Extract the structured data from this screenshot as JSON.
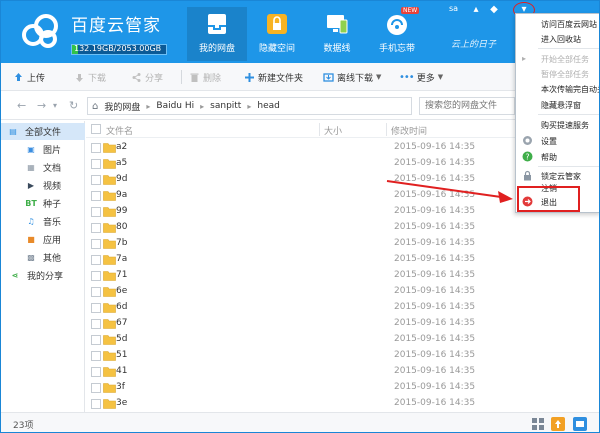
{
  "app": {
    "name": "百度云管家",
    "storage_text": "132.19GB/2053.00GB",
    "storage_used_fraction": 0.064,
    "slogan": "云上的日子",
    "username": "sa"
  },
  "nav": [
    {
      "label": "我的网盘",
      "icon": "cloud-drive-icon",
      "active": true
    },
    {
      "label": "隐藏空间",
      "icon": "lock-icon",
      "active": false
    },
    {
      "label": "数据线",
      "icon": "devices-icon",
      "active": false
    },
    {
      "label": "手机忘带",
      "icon": "phone-remote-icon",
      "active": false,
      "badge": "NEW"
    }
  ],
  "window_controls": {
    "menu": "▾",
    "minimize": "—",
    "maximize": "□",
    "close": "✕"
  },
  "toolbar": [
    {
      "label": "上传",
      "icon": "upload-icon",
      "enabled": true
    },
    {
      "label": "下载",
      "icon": "download-icon",
      "enabled": false
    },
    {
      "label": "分享",
      "icon": "share-icon",
      "enabled": false
    },
    {
      "label": "删除",
      "icon": "delete-icon",
      "enabled": false
    },
    {
      "label": "新建文件夹",
      "icon": "new-folder-icon",
      "enabled": true
    },
    {
      "label": "离线下载",
      "icon": "offline-download-icon",
      "enabled": true
    },
    {
      "label": "更多",
      "icon": "more-icon",
      "enabled": true
    }
  ],
  "breadcrumb": [
    "我的网盘",
    "Baidu Hi",
    "sanpitt",
    "head"
  ],
  "search": {
    "placeholder": "搜索您的网盘文件"
  },
  "sidebar": [
    {
      "label": "全部文件",
      "icon": "all-files-icon",
      "active": true
    },
    {
      "label": "图片",
      "icon": "image-icon",
      "active": false
    },
    {
      "label": "文档",
      "icon": "document-icon",
      "active": false
    },
    {
      "label": "视频",
      "icon": "video-icon",
      "active": false
    },
    {
      "label": "种子",
      "icon": "torrent-icon",
      "active": false
    },
    {
      "label": "音乐",
      "icon": "music-icon",
      "active": false
    },
    {
      "label": "应用",
      "icon": "app-icon",
      "active": false
    },
    {
      "label": "其他",
      "icon": "other-icon",
      "active": false
    },
    {
      "label": "我的分享",
      "icon": "my-share-icon",
      "active": false
    }
  ],
  "columns": {
    "name": "文件名",
    "size": "大小",
    "modified": "修改时间"
  },
  "files": [
    {
      "name": "a2",
      "modified": "2015-09-16 14:35"
    },
    {
      "name": "a5",
      "modified": "2015-09-16 14:35"
    },
    {
      "name": "9d",
      "modified": "2015-09-16 14:35"
    },
    {
      "name": "9a",
      "modified": "2015-09-16 14:35"
    },
    {
      "name": "99",
      "modified": "2015-09-16 14:35"
    },
    {
      "name": "80",
      "modified": "2015-09-16 14:35"
    },
    {
      "name": "7b",
      "modified": "2015-09-16 14:35"
    },
    {
      "name": "7a",
      "modified": "2015-09-16 14:35"
    },
    {
      "name": "71",
      "modified": "2015-09-16 14:35"
    },
    {
      "name": "6e",
      "modified": "2015-09-16 14:35"
    },
    {
      "name": "6d",
      "modified": "2015-09-16 14:35"
    },
    {
      "name": "67",
      "modified": "2015-09-16 14:35"
    },
    {
      "name": "5d",
      "modified": "2015-09-16 14:35"
    },
    {
      "name": "51",
      "modified": "2015-09-16 14:35"
    },
    {
      "name": "41",
      "modified": "2015-09-16 14:35"
    },
    {
      "name": "3f",
      "modified": "2015-09-16 14:35"
    },
    {
      "name": "3e",
      "modified": "2015-09-16 14:35"
    }
  ],
  "status": {
    "count": "23项"
  },
  "dropdown": [
    {
      "label": "访问百度云网站",
      "enabled": true
    },
    {
      "label": "进入回收站",
      "enabled": true
    },
    {
      "separator": true
    },
    {
      "label": "开始全部任务",
      "enabled": false,
      "icon": "play-icon"
    },
    {
      "label": "暂停全部任务",
      "enabled": false
    },
    {
      "label": "本次传输完自动关",
      "enabled": true
    },
    {
      "label": "隐藏悬浮窗",
      "enabled": true
    },
    {
      "separator": true
    },
    {
      "label": "购买提速服务",
      "enabled": true
    },
    {
      "label": "设置",
      "enabled": true,
      "icon": "settings-icon"
    },
    {
      "label": "帮助",
      "enabled": true,
      "icon": "help-icon"
    },
    {
      "separator": true
    },
    {
      "label": "锁定云管家",
      "enabled": true,
      "icon": "padlock-icon"
    },
    {
      "label": "注销",
      "enabled": true
    },
    {
      "label": "退出",
      "enabled": true,
      "icon": "exit-icon"
    }
  ],
  "colors": {
    "header": "#1e96e8",
    "accent_red": "#e02020",
    "folder": "#f5c242"
  }
}
